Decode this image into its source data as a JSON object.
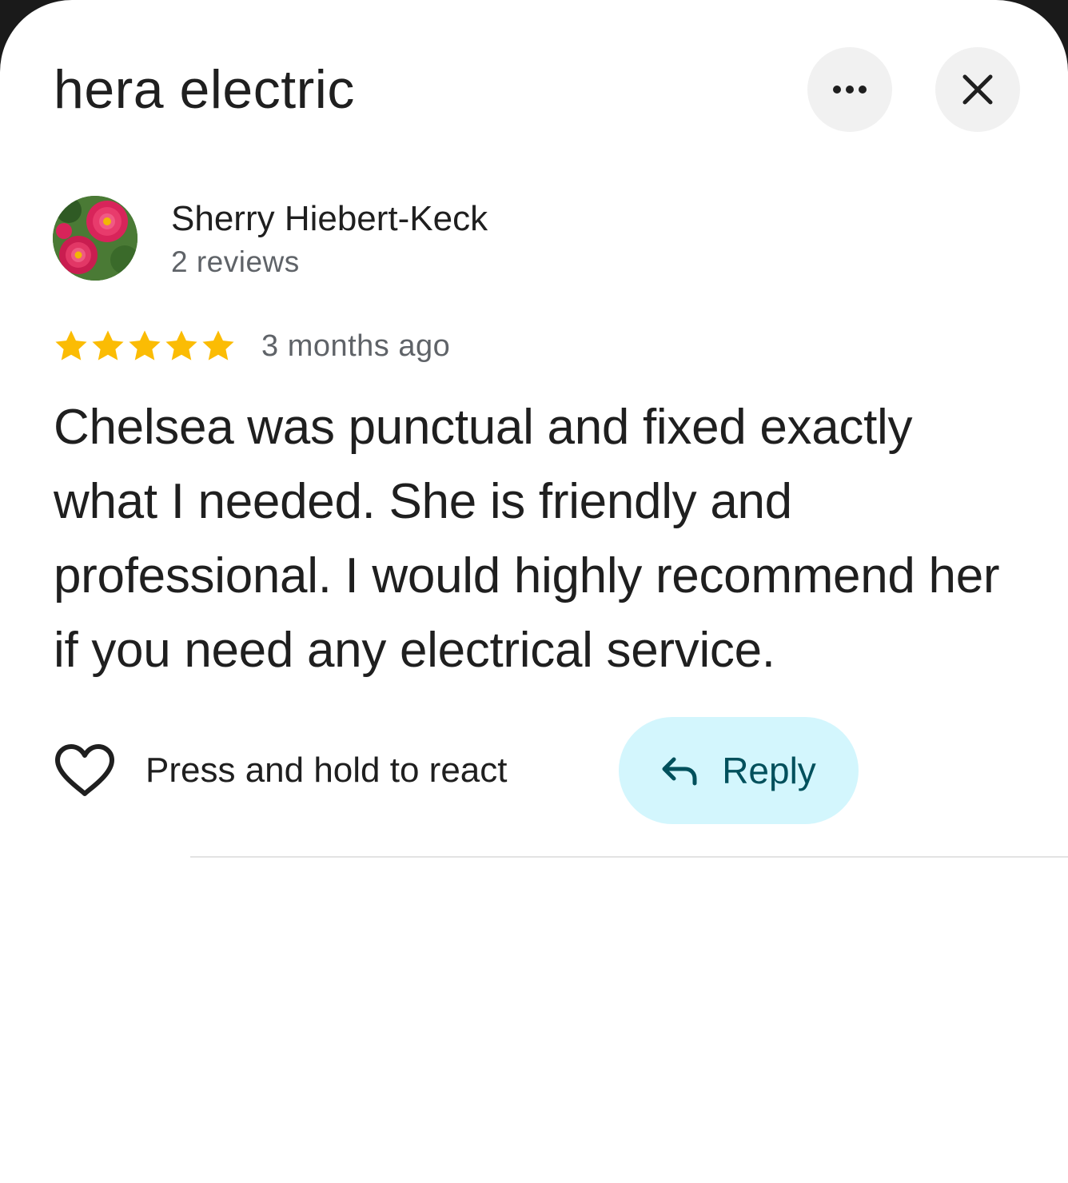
{
  "header": {
    "title": "hera electric",
    "more_icon": "more-horizontal-icon",
    "close_icon": "close-icon"
  },
  "review": {
    "reviewer_name": "Sherry Hiebert-Keck",
    "reviewer_meta": "2 reviews",
    "rating": 5,
    "rating_max": 5,
    "star_color": "#fbbc04",
    "date": "3 months ago",
    "text": "Chelsea was punctual and fixed exactly what I needed. She is friendly and professional. I would highly recommend her if you need any electrical service."
  },
  "actions": {
    "react_icon": "heart-outline-icon",
    "react_label": "Press and hold to react",
    "reply_icon": "reply-arrow-icon",
    "reply_label": "Reply",
    "reply_bg_color": "#d3f6fd",
    "reply_text_color": "#00505c"
  }
}
